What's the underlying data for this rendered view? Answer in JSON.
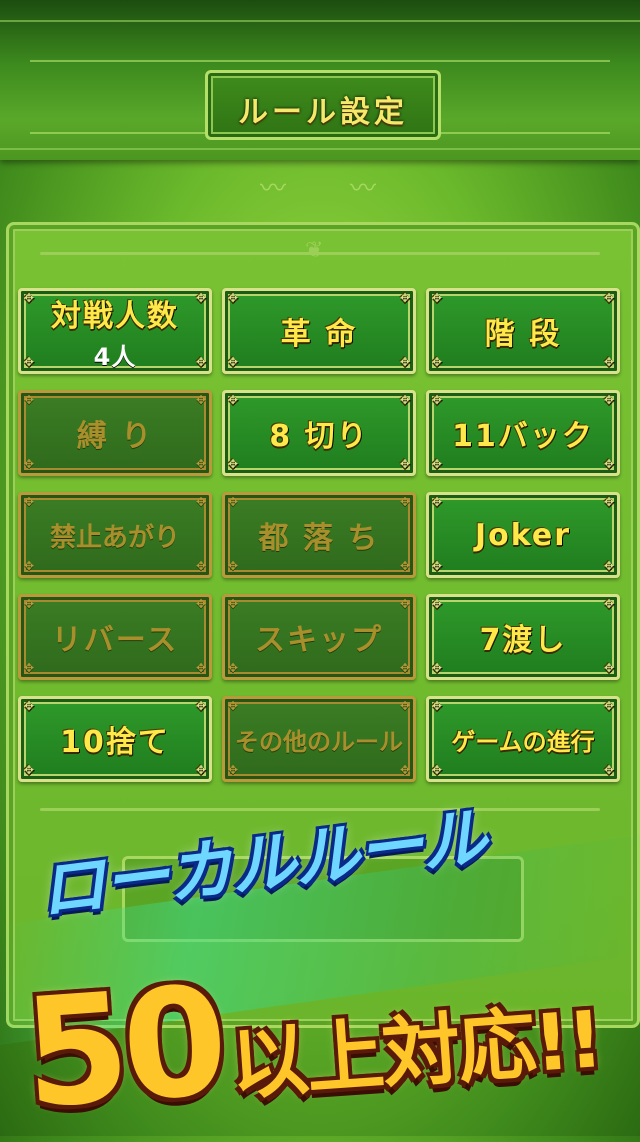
{
  "header": {
    "title": "ルール設定"
  },
  "rules": [
    {
      "label": "対戦人数",
      "sub": "4人",
      "enabled": true
    },
    {
      "label": "革 命",
      "enabled": true
    },
    {
      "label": "階 段",
      "enabled": true
    },
    {
      "label": "縛 り",
      "enabled": false
    },
    {
      "label": "8 切り",
      "enabled": true
    },
    {
      "label": "11バック",
      "enabled": true
    },
    {
      "label": "禁止あがり",
      "enabled": false
    },
    {
      "label": "都 落 ち",
      "enabled": false
    },
    {
      "label": "Joker",
      "enabled": true
    },
    {
      "label": "リバース",
      "enabled": false
    },
    {
      "label": "スキップ",
      "enabled": false
    },
    {
      "label": "7渡し",
      "enabled": true
    },
    {
      "label": "10捨て",
      "enabled": true
    },
    {
      "label": "その他のルール",
      "enabled": false
    },
    {
      "label": "ゲームの進行",
      "enabled": true
    }
  ],
  "promo": {
    "line1": "ローカルルール",
    "number": "50",
    "line2": "以上対応!!"
  },
  "colors": {
    "enabled_text": "#ffe94a",
    "disabled_text": "#a88f2c",
    "panel_bg": "#6ab52b",
    "banner_blue": "#6fd6ff",
    "banner_gold": "#ffc62a"
  }
}
